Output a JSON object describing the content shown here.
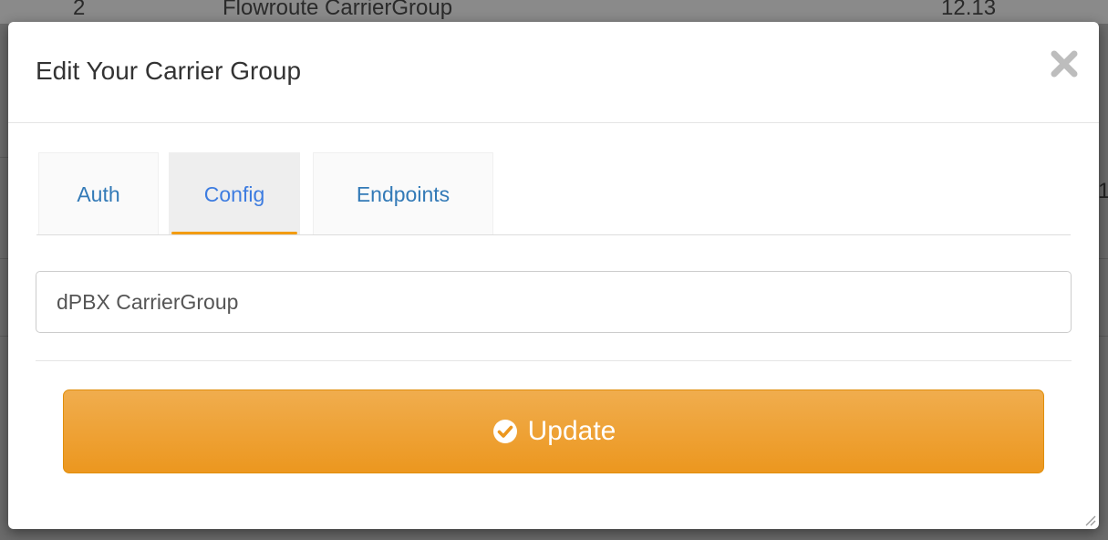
{
  "background_table": {
    "row": {
      "num": "2",
      "name": "Flowroute CarrierGroup",
      "value": "12.13"
    },
    "right_fragment": "1"
  },
  "modal": {
    "title": "Edit Your Carrier Group",
    "close_icon": "close-icon",
    "tabs": [
      {
        "label": "Auth",
        "active": false
      },
      {
        "label": "Config",
        "active": true
      },
      {
        "label": "Endpoints",
        "active": false
      }
    ],
    "name_field": {
      "value": "dPBX CarrierGroup"
    },
    "update_button": {
      "label": "Update",
      "icon": "check-circle-icon"
    }
  },
  "colors": {
    "accent_orange": "#f0ad4e",
    "tab_link": "#337ab7",
    "active_underline": "#f39c12"
  }
}
